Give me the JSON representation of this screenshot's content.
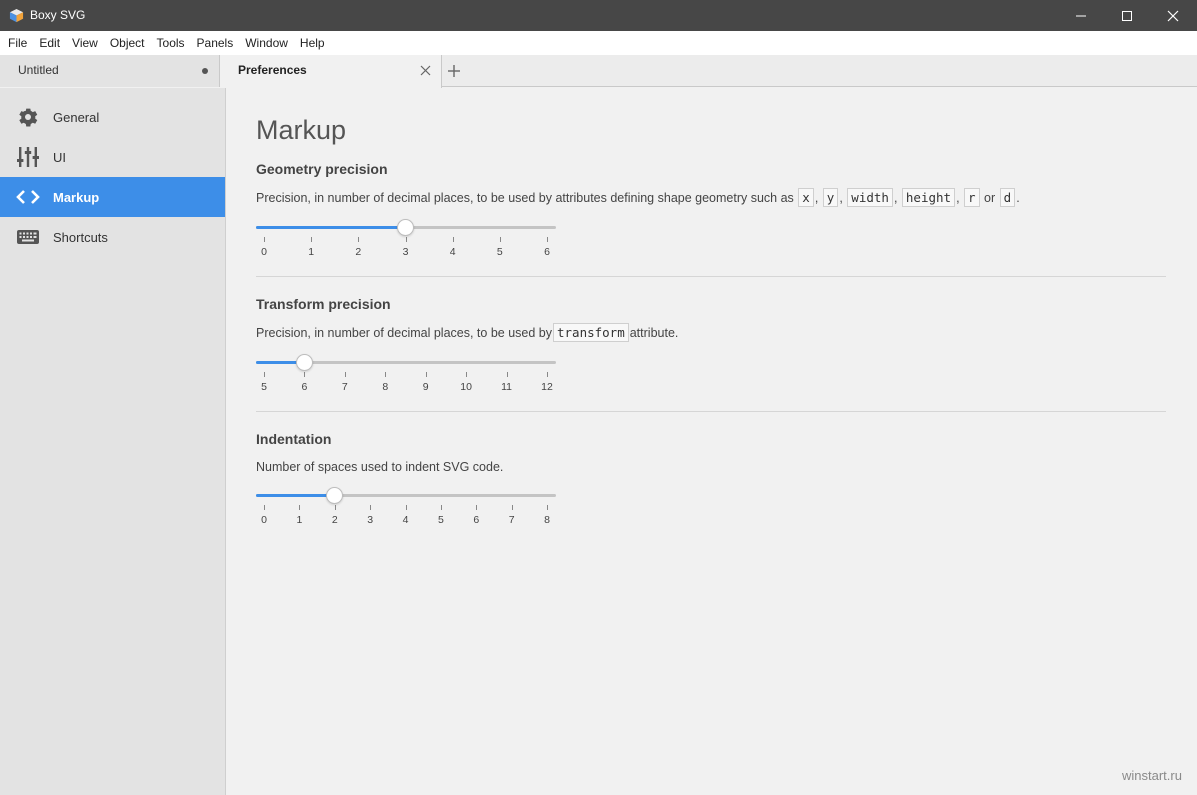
{
  "window": {
    "title": "Boxy SVG",
    "controls": [
      "minimize-icon",
      "maximize-icon",
      "close-icon"
    ]
  },
  "menu": [
    "File",
    "Edit",
    "View",
    "Object",
    "Tools",
    "Panels",
    "Window",
    "Help"
  ],
  "tabs": [
    {
      "label": "Untitled",
      "modified": true
    },
    {
      "label": "Preferences",
      "active": true
    }
  ],
  "sidebar": {
    "items": [
      {
        "label": "General",
        "icon": "gear-icon"
      },
      {
        "label": "UI",
        "icon": "sliders-icon"
      },
      {
        "label": "Markup",
        "icon": "code-icon",
        "active": true
      },
      {
        "label": "Shortcuts",
        "icon": "keyboard-icon"
      }
    ]
  },
  "main": {
    "title": "Markup",
    "geometry": {
      "title": "Geometry precision",
      "desc_prefix": "Precision, in number of decimal places, to be used by attributes defining shape geometry such as",
      "codes": [
        "x",
        "y",
        "width",
        "height",
        "r",
        "d"
      ],
      "sep1": ",",
      "sep2": ",",
      "sep3": ",",
      "sep4": ",",
      "or": "or",
      "end": ".",
      "ticks": [
        "0",
        "1",
        "2",
        "3",
        "4",
        "5",
        "6"
      ],
      "value": 3
    },
    "transform": {
      "title": "Transform precision",
      "desc_prefix": "Precision, in number of decimal places, to be used by",
      "code": "transform",
      "desc_suffix": "attribute.",
      "ticks": [
        "5",
        "6",
        "7",
        "8",
        "9",
        "10",
        "11",
        "12"
      ],
      "value": 6
    },
    "indentation": {
      "title": "Indentation",
      "desc": "Number of spaces used to indent SVG code.",
      "ticks": [
        "0",
        "1",
        "2",
        "3",
        "4",
        "5",
        "6",
        "7",
        "8"
      ],
      "value": 2
    }
  },
  "watermark": "winstart.ru",
  "colors": {
    "accent": "#3d8ee8",
    "titlebar": "#474747"
  }
}
